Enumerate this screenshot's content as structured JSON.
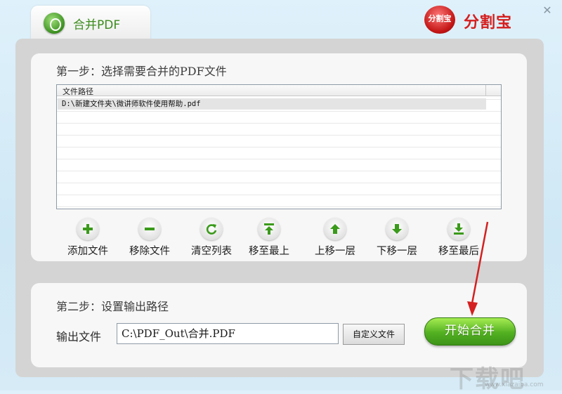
{
  "window": {
    "tab_title": "合并PDF",
    "brand_logo_text": "分割宝",
    "brand_title": "分割宝",
    "close_symbol": "✕"
  },
  "step1": {
    "title": "第一步：选择需要合并的PDF文件",
    "list": {
      "column_header": "文件路径",
      "rows": [
        "D:\\新建文件夹\\微讲师软件使用帮助.pdf"
      ]
    },
    "toolbar": [
      {
        "label": "添加文件",
        "icon": "plus-icon"
      },
      {
        "label": "移除文件",
        "icon": "minus-icon"
      },
      {
        "label": "清空列表",
        "icon": "refresh-icon"
      },
      {
        "label": "移至最上",
        "icon": "move-top-icon"
      },
      {
        "label": "上移一层",
        "icon": "arrow-up-icon"
      },
      {
        "label": "下移一层",
        "icon": "arrow-down-icon"
      },
      {
        "label": "移至最后",
        "icon": "move-bottom-icon"
      }
    ]
  },
  "step2": {
    "title": "第二步：设置输出路径",
    "output_label": "输出文件",
    "output_value": "C:\\PDF_Out\\合并.PDF",
    "custom_button": "自定义文件",
    "start_button": "开始合并"
  },
  "colors": {
    "accent_green": "#52b021",
    "brand_red": "#d51e1e",
    "arrow_red": "#d42020"
  },
  "watermark": {
    "main": "下载吧",
    "sub": "www.xiazaiba.com"
  }
}
